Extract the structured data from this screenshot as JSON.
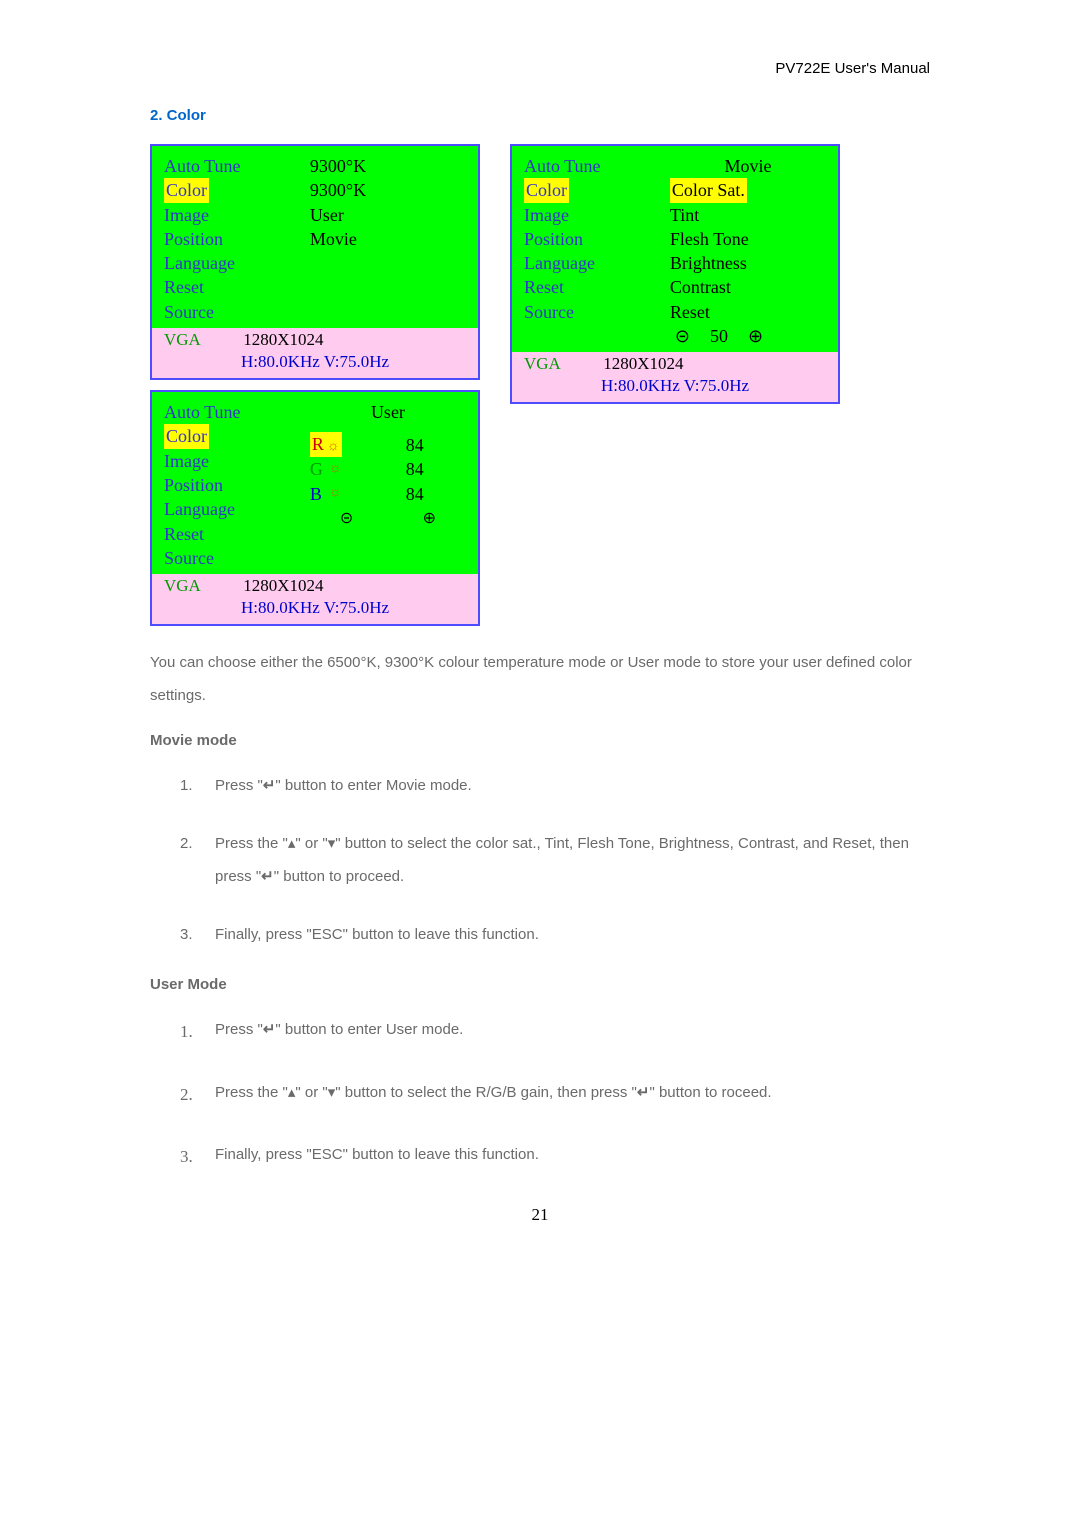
{
  "header": {
    "title": "PV722E User's Manual"
  },
  "section": {
    "title": "2. Color"
  },
  "osd1": {
    "menu": [
      "Auto Tune",
      "Color",
      "Image",
      "Position",
      "Language",
      "Reset",
      "Source"
    ],
    "options": [
      "9300°K",
      "9300°K",
      "User",
      "Movie"
    ],
    "status": {
      "vga": "VGA",
      "res": "1280X1024",
      "freq": "H:80.0KHz  V:75.0Hz"
    }
  },
  "osd2": {
    "menu": [
      "Auto Tune",
      "Color",
      "Image",
      "Position",
      "Language",
      "Reset",
      "Source"
    ],
    "title": "Movie",
    "options": [
      "Color Sat.",
      "Tint",
      "Flesh Tone",
      "Brightness",
      "Contrast",
      "Reset"
    ],
    "slider_val": "50",
    "status": {
      "vga": "VGA",
      "res": "1280X1024",
      "freq": "H:80.0KHz  V:75.0Hz"
    }
  },
  "osd3": {
    "menu": [
      "Auto Tune",
      "Color",
      "Image",
      "Position",
      "Language",
      "Reset",
      "Source"
    ],
    "title": "User",
    "rgb": {
      "r": "84",
      "g": "84",
      "b": "84"
    },
    "status": {
      "vga": "VGA",
      "res": "1280X1024",
      "freq": "H:80.0KHz  V:75.0Hz"
    }
  },
  "paragraph": "You can choose either the 6500°K, 9300°K colour temperature mode or User mode to store your user defined color settings.",
  "movie_mode": {
    "heading": "Movie mode",
    "items": [
      {
        "n": "1.",
        "pre": "Press \"",
        "post": "\" button to enter Movie mode."
      },
      {
        "n": "2.",
        "text": "Press the \"▴\" or \"▾\" button to select the color sat., Tint, Flesh Tone, Brightness, Contrast, and Reset, then press \"",
        "post": "\" button to proceed."
      },
      {
        "n": "3.",
        "text": "Finally, press \"ESC\" button to leave this function."
      }
    ]
  },
  "user_mode": {
    "heading": "User Mode",
    "items": [
      {
        "n": "1.",
        "pre": "Press \"",
        "post": "\" button to enter User mode."
      },
      {
        "n": "2.",
        "text": "Press the \"▴\" or \"▾\" button to select the R/G/B gain, then press \"",
        "post": "\" button to roceed."
      },
      {
        "n": "3.",
        "text": "Finally, press \"ESC\" button to leave this function."
      }
    ]
  },
  "page_number": "21",
  "icons": {
    "enter": "↵",
    "left_arrow": "⊝",
    "right_arrow": "⊕",
    "sun": "☼"
  }
}
